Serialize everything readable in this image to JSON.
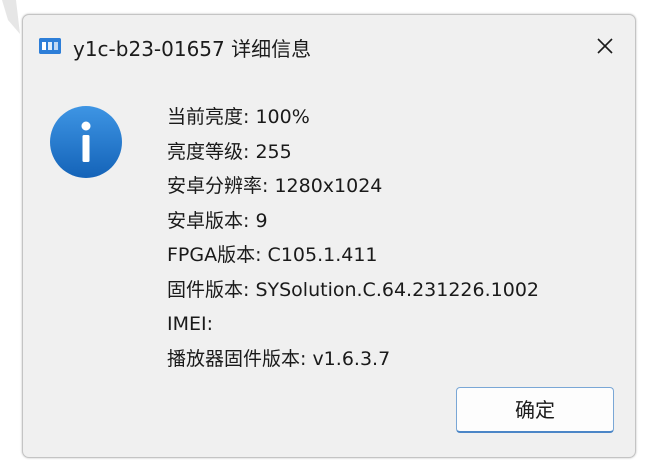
{
  "dialog": {
    "title": "y1c-b23-01657 详细信息",
    "app_icon": "app-logo-icon",
    "close_icon": "close-icon",
    "info_icon": "info-icon",
    "accent_color": "#1e73c8",
    "lines": [
      "当前亮度: 100%",
      "亮度等级: 255",
      "安卓分辨率: 1280x1024",
      "安卓版本: 9",
      "FPGA版本: C105.1.411",
      "固件版本: SYSolution.C.64.231226.1002",
      "IMEI:",
      "播放器固件版本: v1.6.3.7"
    ],
    "ok_label": "确定"
  }
}
